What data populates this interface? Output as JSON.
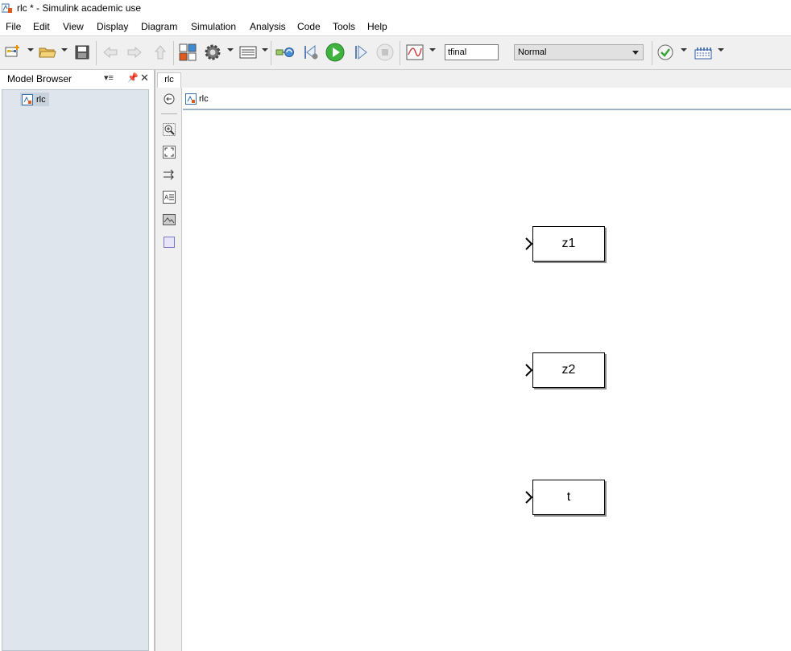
{
  "window": {
    "title": "rlc * - Simulink academic use"
  },
  "menu": [
    "File",
    "Edit",
    "View",
    "Display",
    "Diagram",
    "Simulation",
    "Analysis",
    "Code",
    "Tools",
    "Help"
  ],
  "toolbar": {
    "stop_time": "tfinal",
    "sim_mode": "Normal",
    "icons": [
      "new-model-icon",
      "open-icon",
      "save-icon",
      "back-icon",
      "forward-icon",
      "up-icon",
      "library-browser-icon",
      "model-config-icon",
      "explorer-icon",
      "update-icon",
      "step-back-icon",
      "run-icon",
      "step-forward-icon",
      "stop-icon",
      "data-inspector-icon",
      "model-advisor-icon",
      "build-icon"
    ]
  },
  "model_browser": {
    "title": "Model Browser",
    "tree": [
      {
        "label": "rlc"
      }
    ]
  },
  "editor": {
    "tab": "rlc",
    "breadcrumb": "rlc",
    "blocks": [
      {
        "label": "z1"
      },
      {
        "label": "z2"
      },
      {
        "label": "t"
      }
    ]
  },
  "colors": {
    "tree_bg": "#dfe5ed",
    "toolbar_bg": "#f0f0f0",
    "run_green": "#3fb23f"
  }
}
